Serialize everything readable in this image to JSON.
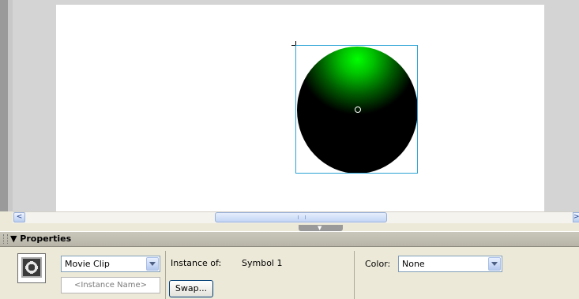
{
  "stage": {
    "selected_object": "green gradient circle movie clip"
  },
  "scrollbar": {
    "left_arrow": "<",
    "right_arrow": ">"
  },
  "properties_panel": {
    "title": "▼ Properties",
    "symbol_type": "Movie Clip",
    "instance_name_placeholder": "<Instance Name>",
    "instance_of_label": "Instance of:",
    "instance_of_value": "Symbol 1",
    "swap_label": "Swap...",
    "color_label": "Color:",
    "color_value": "None"
  },
  "colors": {
    "selection_border": "#2aa3d6",
    "ball_highlight": "#00ff00",
    "panel_background": "#ece9d8",
    "stage_background": "#ffffff"
  },
  "icons": {
    "symbol_icon": "movie-clip-symbol-icon",
    "dropdown_icon": "chevron-down-icon"
  }
}
